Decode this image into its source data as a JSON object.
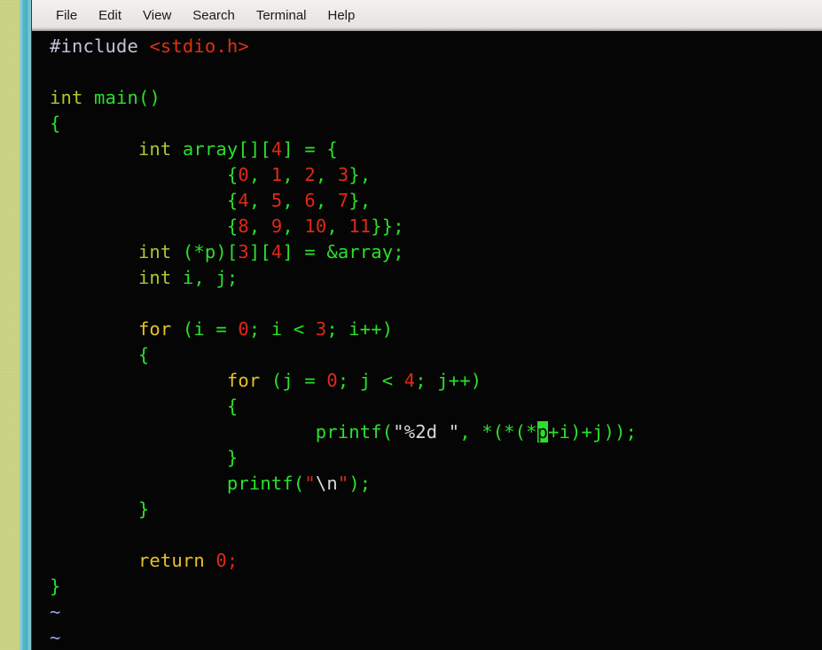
{
  "window": {
    "border_color": "#52b4c6",
    "desktop_color": "#ccd684",
    "terminal_bg": "#050505"
  },
  "menubar": {
    "items": [
      {
        "label": "File",
        "name": "menu-file"
      },
      {
        "label": "Edit",
        "name": "menu-edit"
      },
      {
        "label": "View",
        "name": "menu-view"
      },
      {
        "label": "Search",
        "name": "menu-search"
      },
      {
        "label": "Terminal",
        "name": "menu-terminal"
      },
      {
        "label": "Help",
        "name": "menu-help"
      }
    ]
  },
  "editor": {
    "application": "vim",
    "language": "c",
    "cursor": {
      "char": "p",
      "line": 16,
      "column": 45
    },
    "colors": {
      "preprocessor": "#c8c0d8",
      "include_file": "#e03010",
      "type": "#a8c832",
      "identifier": "#2ae02a",
      "number": "#e02818",
      "keyword": "#e8c02a",
      "string": "#d8d8d8",
      "string_quote": "#d03018",
      "tilde": "#9aa8e8",
      "cursor_bg": "#2ae02a"
    },
    "lines": [
      {
        "n": 1,
        "tokens": [
          {
            "t": "#include ",
            "c": "preproc"
          },
          {
            "t": "<stdio.h>",
            "c": "incfile"
          }
        ]
      },
      {
        "n": 2,
        "tokens": []
      },
      {
        "n": 3,
        "tokens": [
          {
            "t": "int",
            "c": "type"
          },
          {
            "t": " ",
            "c": "ident"
          },
          {
            "t": "main()",
            "c": "ident"
          }
        ]
      },
      {
        "n": 4,
        "tokens": [
          {
            "t": "{",
            "c": "ident"
          }
        ]
      },
      {
        "n": 5,
        "tokens": [
          {
            "t": "        ",
            "c": "ident"
          },
          {
            "t": "int",
            "c": "type"
          },
          {
            "t": " array[][",
            "c": "ident"
          },
          {
            "t": "4",
            "c": "num"
          },
          {
            "t": "] = {",
            "c": "ident"
          }
        ]
      },
      {
        "n": 6,
        "tokens": [
          {
            "t": "                {",
            "c": "ident"
          },
          {
            "t": "0",
            "c": "num"
          },
          {
            "t": ", ",
            "c": "ident"
          },
          {
            "t": "1",
            "c": "num"
          },
          {
            "t": ", ",
            "c": "ident"
          },
          {
            "t": "2",
            "c": "num"
          },
          {
            "t": ", ",
            "c": "ident"
          },
          {
            "t": "3",
            "c": "num"
          },
          {
            "t": "},",
            "c": "ident"
          }
        ]
      },
      {
        "n": 7,
        "tokens": [
          {
            "t": "                {",
            "c": "ident"
          },
          {
            "t": "4",
            "c": "num"
          },
          {
            "t": ", ",
            "c": "ident"
          },
          {
            "t": "5",
            "c": "num"
          },
          {
            "t": ", ",
            "c": "ident"
          },
          {
            "t": "6",
            "c": "num"
          },
          {
            "t": ", ",
            "c": "ident"
          },
          {
            "t": "7",
            "c": "num"
          },
          {
            "t": "},",
            "c": "ident"
          }
        ]
      },
      {
        "n": 8,
        "tokens": [
          {
            "t": "                {",
            "c": "ident"
          },
          {
            "t": "8",
            "c": "num"
          },
          {
            "t": ", ",
            "c": "ident"
          },
          {
            "t": "9",
            "c": "num"
          },
          {
            "t": ", ",
            "c": "ident"
          },
          {
            "t": "10",
            "c": "num"
          },
          {
            "t": ", ",
            "c": "ident"
          },
          {
            "t": "11",
            "c": "num"
          },
          {
            "t": "}};",
            "c": "ident"
          }
        ]
      },
      {
        "n": 9,
        "tokens": [
          {
            "t": "        ",
            "c": "ident"
          },
          {
            "t": "int",
            "c": "type"
          },
          {
            "t": " (*p)[",
            "c": "ident"
          },
          {
            "t": "3",
            "c": "num"
          },
          {
            "t": "][",
            "c": "ident"
          },
          {
            "t": "4",
            "c": "num"
          },
          {
            "t": "] = &array;",
            "c": "ident"
          }
        ]
      },
      {
        "n": 10,
        "tokens": [
          {
            "t": "        ",
            "c": "ident"
          },
          {
            "t": "int",
            "c": "type"
          },
          {
            "t": " i, j;",
            "c": "ident"
          }
        ]
      },
      {
        "n": 11,
        "tokens": []
      },
      {
        "n": 12,
        "tokens": [
          {
            "t": "        ",
            "c": "ident"
          },
          {
            "t": "for",
            "c": "keyword"
          },
          {
            "t": " (i = ",
            "c": "ident"
          },
          {
            "t": "0",
            "c": "num"
          },
          {
            "t": "; i < ",
            "c": "ident"
          },
          {
            "t": "3",
            "c": "num"
          },
          {
            "t": "; i++)",
            "c": "ident"
          }
        ]
      },
      {
        "n": 13,
        "tokens": [
          {
            "t": "        {",
            "c": "ident"
          }
        ]
      },
      {
        "n": 14,
        "tokens": [
          {
            "t": "                ",
            "c": "ident"
          },
          {
            "t": "for",
            "c": "keyword"
          },
          {
            "t": " (j = ",
            "c": "ident"
          },
          {
            "t": "0",
            "c": "num"
          },
          {
            "t": "; j < ",
            "c": "ident"
          },
          {
            "t": "4",
            "c": "num"
          },
          {
            "t": "; j++)",
            "c": "ident"
          }
        ]
      },
      {
        "n": 15,
        "tokens": [
          {
            "t": "                {",
            "c": "ident"
          }
        ]
      },
      {
        "n": 16,
        "tokens": [
          {
            "t": "                        printf(",
            "c": "ident"
          },
          {
            "t": "\"%2d \"",
            "c": "str"
          },
          {
            "t": ", *(*(*",
            "c": "ident"
          },
          {
            "t": "p",
            "c": "cursor"
          },
          {
            "t": "+i)+j));",
            "c": "ident"
          }
        ]
      },
      {
        "n": 17,
        "tokens": [
          {
            "t": "                }",
            "c": "ident"
          }
        ]
      },
      {
        "n": 18,
        "tokens": [
          {
            "t": "                printf(",
            "c": "ident"
          },
          {
            "t": "\"",
            "c": "strq"
          },
          {
            "t": "\\n",
            "c": "str"
          },
          {
            "t": "\"",
            "c": "strq"
          },
          {
            "t": ");",
            "c": "ident"
          }
        ]
      },
      {
        "n": 19,
        "tokens": [
          {
            "t": "        }",
            "c": "ident"
          }
        ]
      },
      {
        "n": 20,
        "tokens": []
      },
      {
        "n": 21,
        "tokens": [
          {
            "t": "        ",
            "c": "ident"
          },
          {
            "t": "return",
            "c": "keyword"
          },
          {
            "t": " ",
            "c": "ident"
          },
          {
            "t": "0",
            "c": "num"
          },
          {
            "t": ";",
            "c": "num"
          }
        ]
      },
      {
        "n": 22,
        "tokens": [
          {
            "t": "}",
            "c": "ident"
          }
        ]
      },
      {
        "n": 23,
        "tokens": [
          {
            "t": "~",
            "c": "tilde"
          }
        ]
      },
      {
        "n": 24,
        "tokens": [
          {
            "t": "~",
            "c": "tilde"
          }
        ]
      }
    ]
  }
}
